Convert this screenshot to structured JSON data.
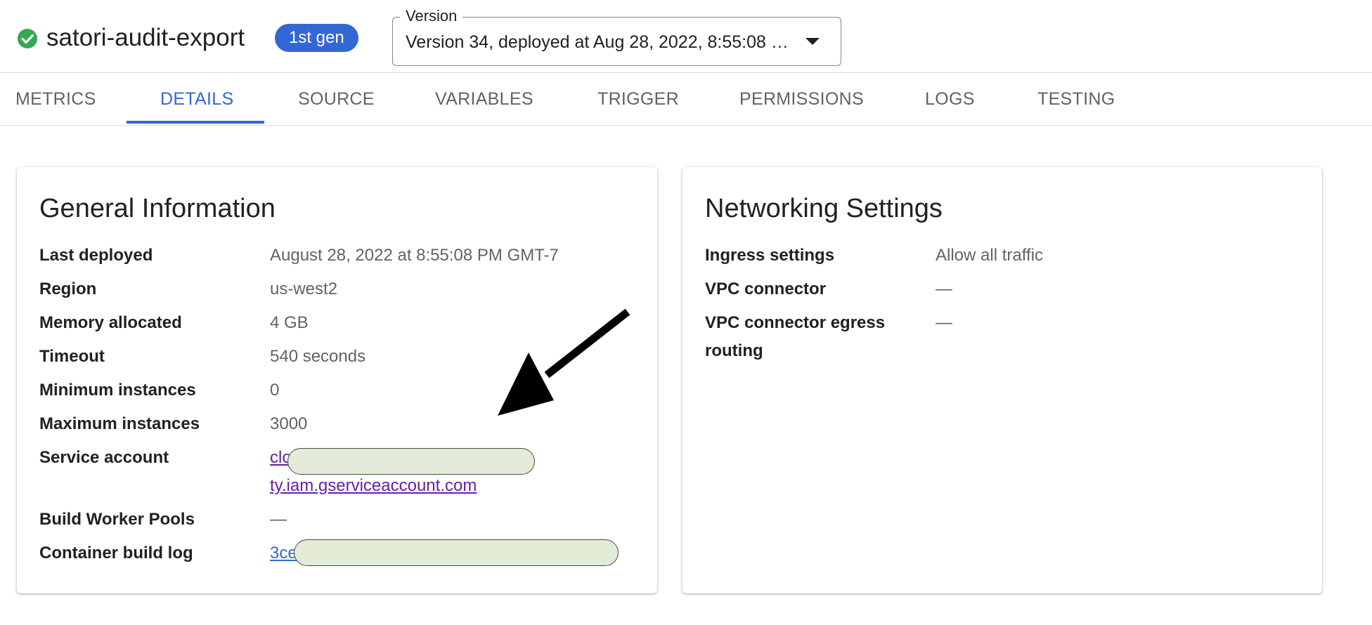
{
  "header": {
    "function_name": "satori-audit-export",
    "status_icon": "check-circle-icon",
    "status_color": "#34a853",
    "gen_badge": "1st gen",
    "version": {
      "label": "Version",
      "value": "Version 34, deployed at Aug 28, 2022, 8:55:08 PM"
    }
  },
  "tabs": [
    {
      "label": "METRICS",
      "active": false
    },
    {
      "label": "DETAILS",
      "active": true
    },
    {
      "label": "SOURCE",
      "active": false
    },
    {
      "label": "VARIABLES",
      "active": false
    },
    {
      "label": "TRIGGER",
      "active": false
    },
    {
      "label": "PERMISSIONS",
      "active": false
    },
    {
      "label": "LOGS",
      "active": false
    },
    {
      "label": "TESTING",
      "active": false
    }
  ],
  "general": {
    "title": "General Information",
    "rows": [
      {
        "label": "Last deployed",
        "value": "August 28, 2022 at 8:55:08 PM GMT-7"
      },
      {
        "label": "Region",
        "value": "us-west2"
      },
      {
        "label": "Memory allocated",
        "value": "4 GB"
      },
      {
        "label": "Timeout",
        "value": "540 seconds"
      },
      {
        "label": "Minimum instances",
        "value": "0"
      },
      {
        "label": "Maximum instances",
        "value": "3000"
      },
      {
        "label": "Service account",
        "value_line1": "clo",
        "value_line2": "ty.iam.gserviceaccount.com"
      },
      {
        "label": "Build Worker Pools",
        "value": "—"
      },
      {
        "label": "Container build log",
        "value": "3ce"
      }
    ]
  },
  "networking": {
    "title": "Networking Settings",
    "rows": [
      {
        "label": "Ingress settings",
        "value": "Allow all traffic"
      },
      {
        "label": "VPC connector",
        "value": "—"
      },
      {
        "label": "VPC connector egress",
        "label_line2": "routing",
        "value": "—"
      }
    ]
  },
  "colors": {
    "accent": "#3367d6",
    "link_visited": "#681da8",
    "redaction_fill": "#e2ecd7"
  }
}
